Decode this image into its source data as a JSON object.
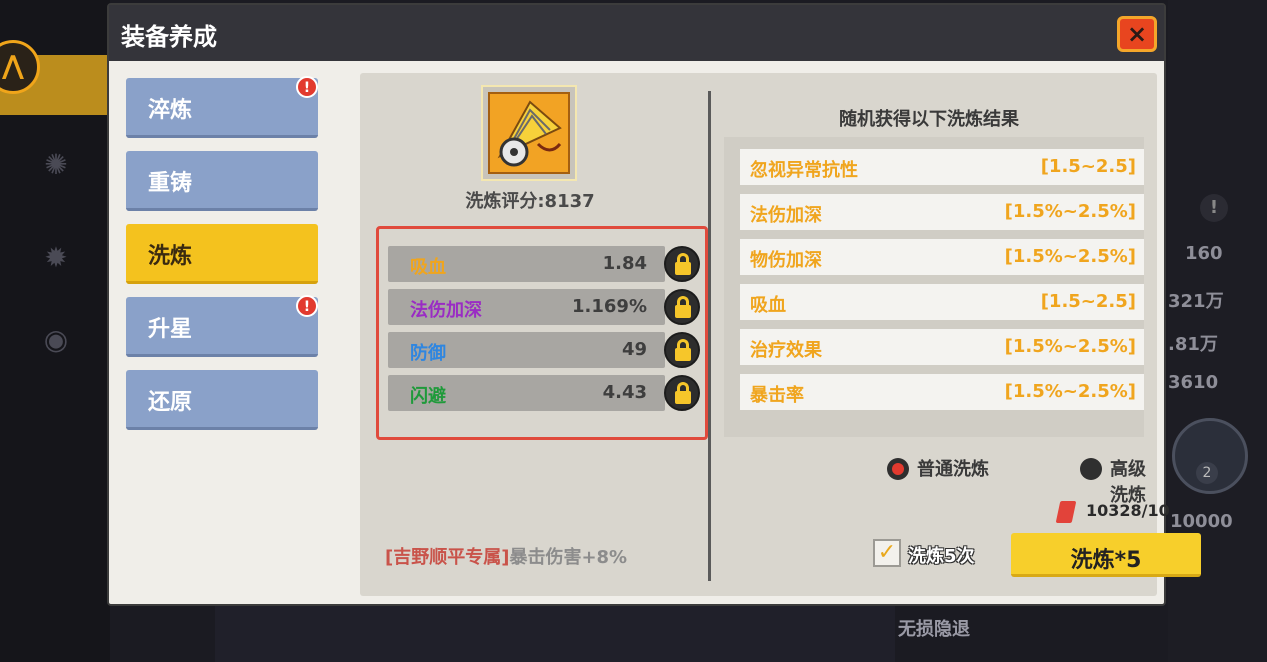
{
  "background": {
    "right_values": [
      "160",
      "321万",
      ".81万",
      "3610",
      "10000"
    ],
    "bottom_text": "无损隐退",
    "wheel_number": "2"
  },
  "modal": {
    "title": "装备养成",
    "close_label": "×"
  },
  "tabs": [
    {
      "label": "淬炼",
      "alert": true
    },
    {
      "label": "重铸",
      "alert": false
    },
    {
      "label": "洗炼",
      "alert": false,
      "active": true
    },
    {
      "label": "升星",
      "alert": true
    },
    {
      "label": "还原",
      "alert": false
    }
  ],
  "alert_glyph": "!",
  "item": {
    "icon": "gilded-fan-icon",
    "score_text": "洗炼评分:8137"
  },
  "attributes": [
    {
      "name": "吸血",
      "value": "1.84",
      "color": "#f0a51e"
    },
    {
      "name": "法伤加深",
      "value": "1.169%",
      "color": "#9a2cc4"
    },
    {
      "name": "防御",
      "value": "49",
      "color": "#2f86e0"
    },
    {
      "name": "闪避",
      "value": "4.43",
      "color": "#1f9a3a"
    }
  ],
  "exclusive": {
    "tag": "[吉野顺平专属]",
    "effect": "暴击伤害+8%"
  },
  "results": {
    "title": "随机获得以下洗炼结果",
    "rows": [
      {
        "name": "忽视异常抗性",
        "range": "[1.5~2.5]"
      },
      {
        "name": "法伤加深",
        "range": "[1.5%~2.5%]"
      },
      {
        "name": "物伤加深",
        "range": "[1.5%~2.5%]"
      },
      {
        "name": "吸血",
        "range": "[1.5~2.5]"
      },
      {
        "name": "治疗效果",
        "range": "[1.5%~2.5%]"
      },
      {
        "name": "暴击率",
        "range": "[1.5%~2.5%]"
      }
    ]
  },
  "modes": {
    "normal_label": "普通洗炼",
    "normal_selected": true,
    "advanced_label": "高级洗炼",
    "advanced_selected": false
  },
  "cost": {
    "icon": "red-crystal-icon",
    "text": "10328/10"
  },
  "batch": {
    "checked": true,
    "check_glyph": "✓",
    "label": "洗炼5次"
  },
  "action": {
    "label": "洗炼*5"
  }
}
